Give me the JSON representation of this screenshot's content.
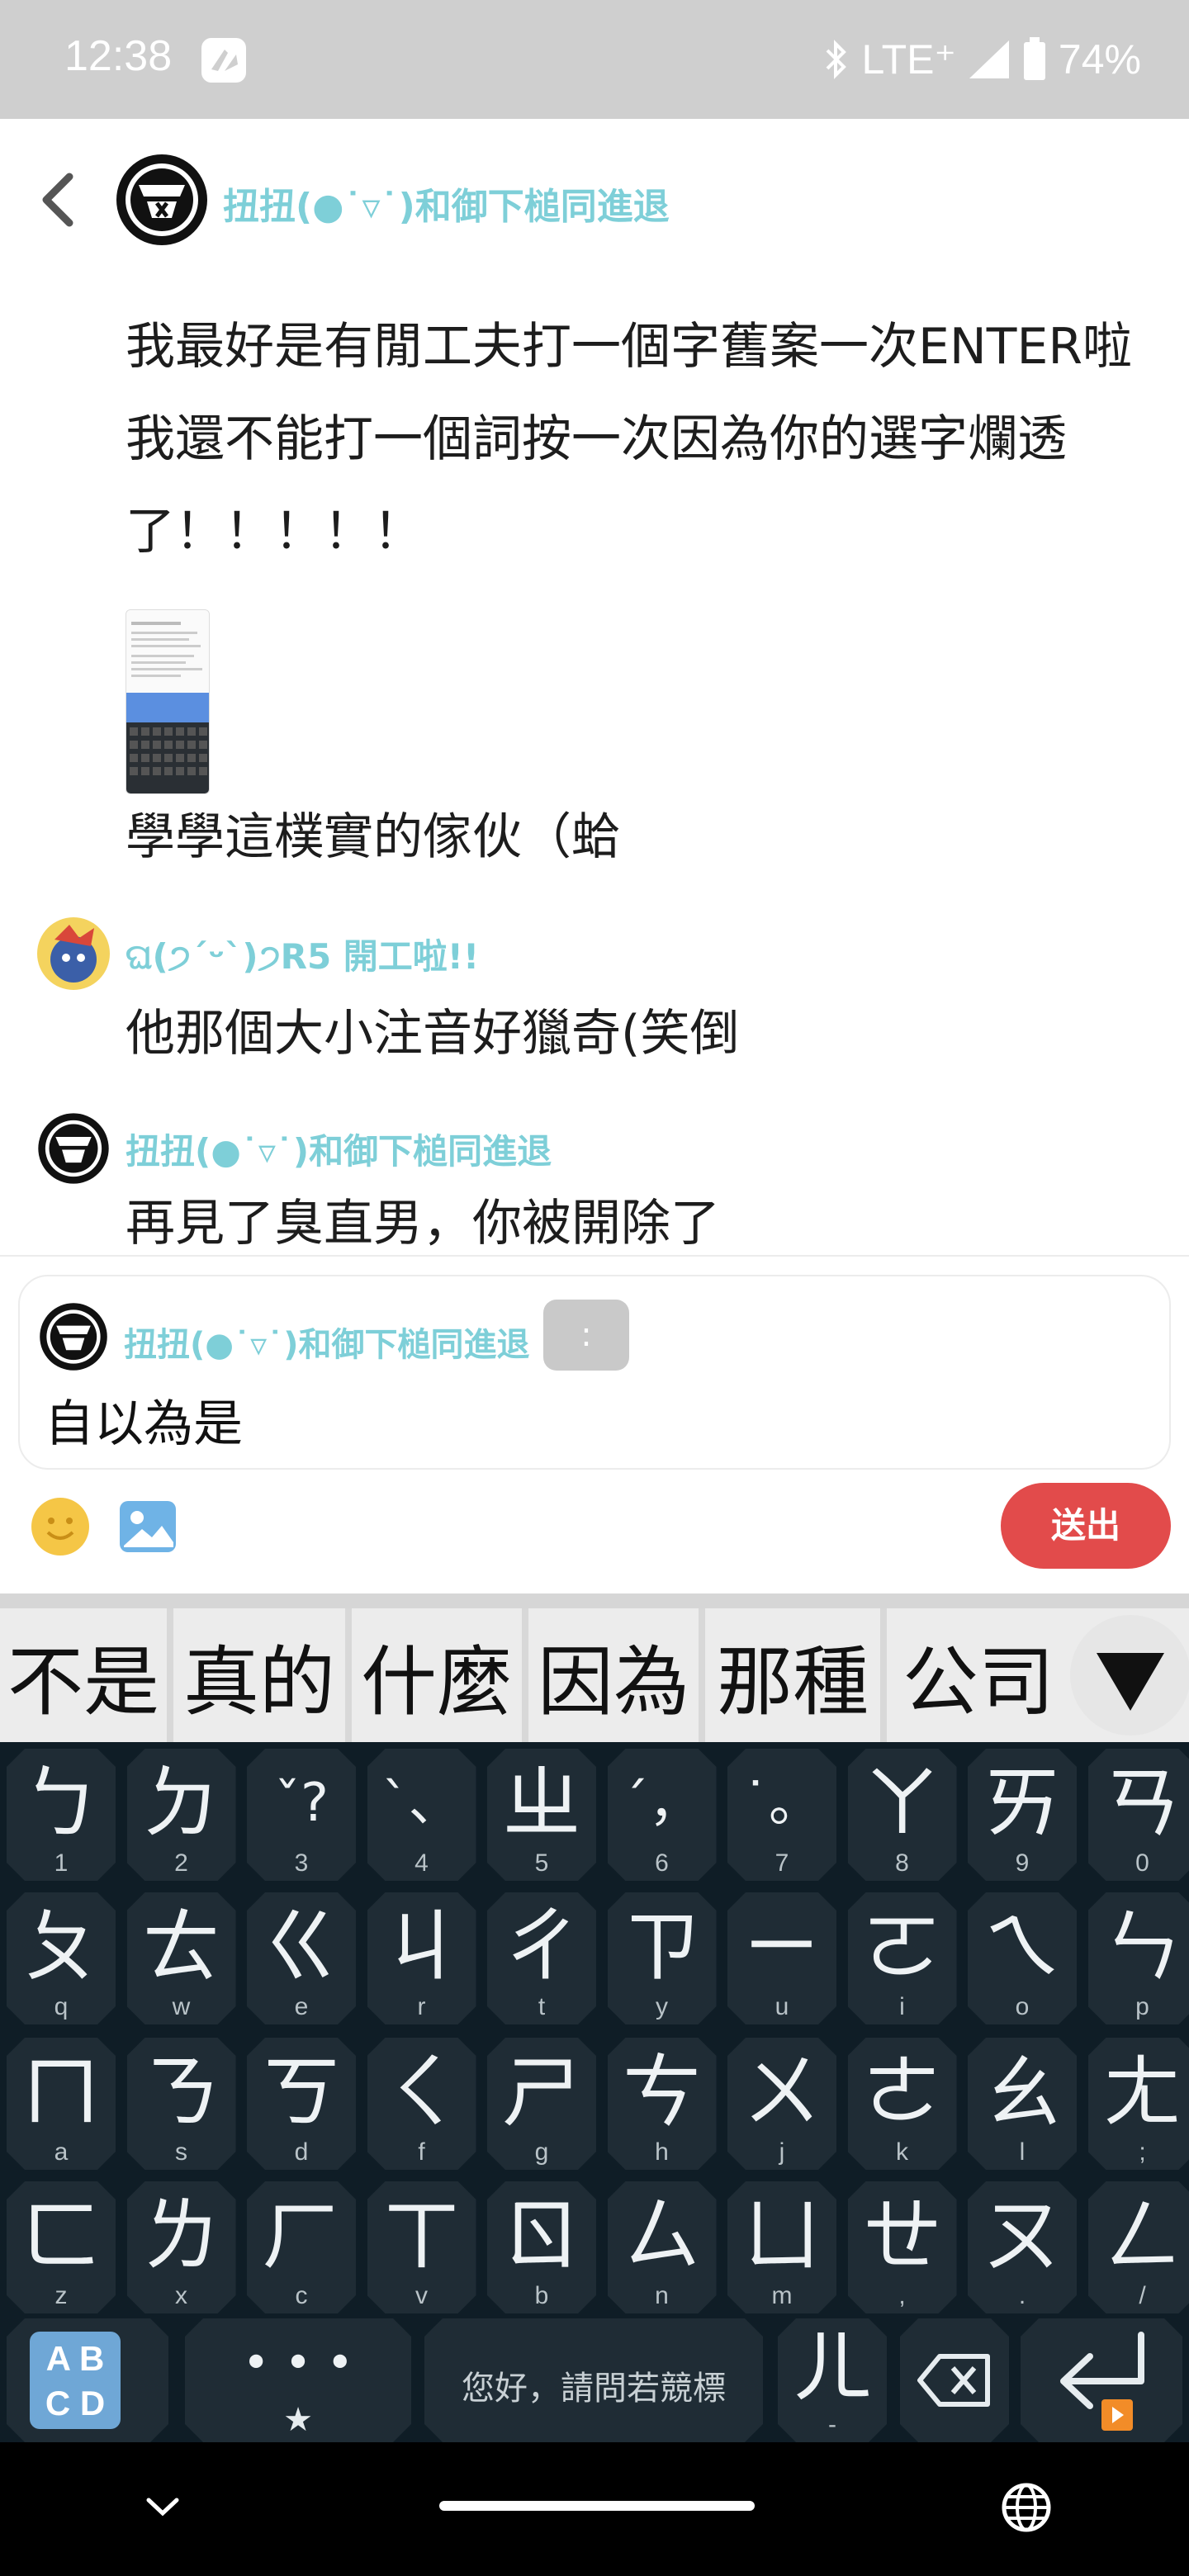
{
  "status_bar": {
    "time": "12:38",
    "network": "LTE⁺",
    "battery": "74%"
  },
  "chat": {
    "title": "扭扭(●˙▿˙)和御下槌同進退",
    "messages": {
      "m1": "我最好是有閒工夫打一個字舊案一次ENTER啦我還不能打一個詞按一次因為你的選字爛透了！！！！！",
      "m2": "學學這樸實的傢伙（蛤",
      "sender2": "ଘ(੭ˊᵕˋ)੭R5 開工啦!!",
      "m3": "他那個大小注音好獵奇(笑倒",
      "sender3": "扭扭(●˙▿˙)和御下槌同進退",
      "m4": "再見了臭直男，你被開除了"
    }
  },
  "composer": {
    "quoted_name": "扭扭(●˙▿˙)和御下槌同進退",
    "colon_chip": ":",
    "input_value": "自以為是",
    "send_label": "送出"
  },
  "candidates": [
    "不是",
    "真的",
    "什麼",
    "因為",
    "那種",
    "公司"
  ],
  "keyboard": {
    "row1": [
      {
        "g": "ㄅ",
        "s": "1"
      },
      {
        "g": "ㄉ",
        "s": "2"
      },
      {
        "g": "ˇ?",
        "s": "3"
      },
      {
        "g": "ˋ、",
        "s": "4"
      },
      {
        "g": "ㄓ",
        "s": "5"
      },
      {
        "g": "ˊ，",
        "s": "6"
      },
      {
        "g": "˙。",
        "s": "7"
      },
      {
        "g": "ㄚ",
        "s": "8"
      },
      {
        "g": "ㄞ",
        "s": "9"
      },
      {
        "g": "ㄢ",
        "s": "0"
      }
    ],
    "row2": [
      {
        "g": "ㄆ",
        "s": "q"
      },
      {
        "g": "ㄊ",
        "s": "w"
      },
      {
        "g": "ㄍ",
        "s": "e"
      },
      {
        "g": "ㄐ",
        "s": "r"
      },
      {
        "g": "ㄔ",
        "s": "t"
      },
      {
        "g": "ㄗ",
        "s": "y"
      },
      {
        "g": "ㄧ",
        "s": "u"
      },
      {
        "g": "ㄛ",
        "s": "i"
      },
      {
        "g": "ㄟ",
        "s": "o"
      },
      {
        "g": "ㄣ",
        "s": "p"
      }
    ],
    "row3": [
      {
        "g": "ㄇ",
        "s": "a"
      },
      {
        "g": "ㄋ",
        "s": "s"
      },
      {
        "g": "ㄎ",
        "s": "d"
      },
      {
        "g": "ㄑ",
        "s": "f"
      },
      {
        "g": "ㄕ",
        "s": "g"
      },
      {
        "g": "ㄘ",
        "s": "h"
      },
      {
        "g": "ㄨ",
        "s": "j"
      },
      {
        "g": "ㄜ",
        "s": "k"
      },
      {
        "g": "ㄠ",
        "s": "l"
      },
      {
        "g": "ㄤ",
        "s": ";"
      }
    ],
    "row4": [
      {
        "g": "ㄈ",
        "s": "z"
      },
      {
        "g": "ㄌ",
        "s": "x"
      },
      {
        "g": "ㄏ",
        "s": "c"
      },
      {
        "g": "ㄒ",
        "s": "v"
      },
      {
        "g": "ㄖ",
        "s": "b"
      },
      {
        "g": "ㄙ",
        "s": "n"
      },
      {
        "g": "ㄩ",
        "s": "m"
      },
      {
        "g": "ㄝ",
        "s": ","
      },
      {
        "g": "ㄡ",
        "s": "."
      },
      {
        "g": "ㄥ",
        "s": "/"
      }
    ],
    "mode_label": "A B\nC D",
    "symbols_label": "• • •",
    "symbols_sub": "★",
    "space_hint": "您好，請問若競標",
    "er_key": "ㄦ",
    "er_sub": "-"
  },
  "colors": {
    "accent_name": "#7ecfd8",
    "send_button": "#e24b4b",
    "keyboard_bg": "#0f1d26",
    "key_bg": "#1f2c35"
  }
}
